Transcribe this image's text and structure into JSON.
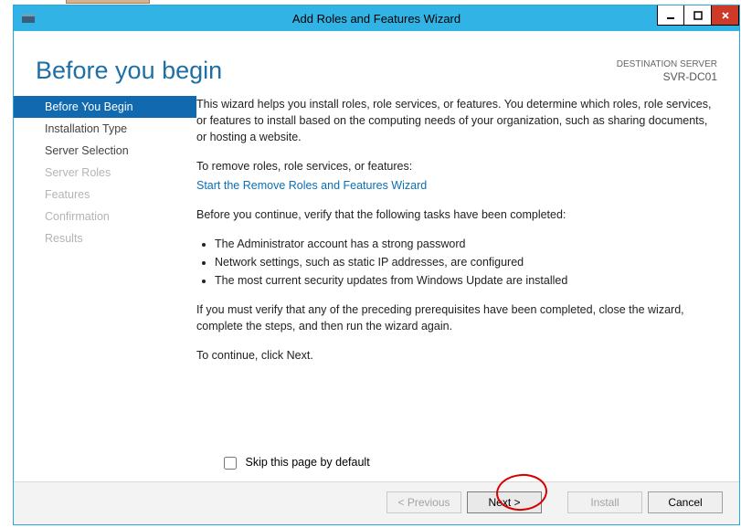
{
  "window": {
    "title": "Add Roles and Features Wizard"
  },
  "header": {
    "page_title": "Before you begin",
    "dest_label": "DESTINATION SERVER",
    "dest_server": "SVR-DC01"
  },
  "nav": {
    "items": [
      {
        "label": "Before You Begin",
        "state": "active"
      },
      {
        "label": "Installation Type",
        "state": "normal"
      },
      {
        "label": "Server Selection",
        "state": "normal"
      },
      {
        "label": "Server Roles",
        "state": "disabled"
      },
      {
        "label": "Features",
        "state": "disabled"
      },
      {
        "label": "Confirmation",
        "state": "disabled"
      },
      {
        "label": "Results",
        "state": "disabled"
      }
    ]
  },
  "content": {
    "intro": "This wizard helps you install roles, role services, or features. You determine which roles, role services, or features to install based on the computing needs of your organization, such as sharing documents, or hosting a website.",
    "remove_label": "To remove roles, role services, or features:",
    "remove_link": "Start the Remove Roles and Features Wizard",
    "pre_label": "Before you continue, verify that the following tasks have been completed:",
    "bullets": [
      "The Administrator account has a strong password",
      "Network settings, such as static IP addresses, are configured",
      "The most current security updates from Windows Update are installed"
    ],
    "post": "If you must verify that any of the preceding prerequisites have been completed, close the wizard, complete the steps, and then run the wizard again.",
    "continue": "To continue, click Next."
  },
  "skip": {
    "label": "Skip this page by default",
    "checked": false
  },
  "footer": {
    "previous": "< Previous",
    "next": "Next >",
    "install": "Install",
    "cancel": "Cancel"
  }
}
